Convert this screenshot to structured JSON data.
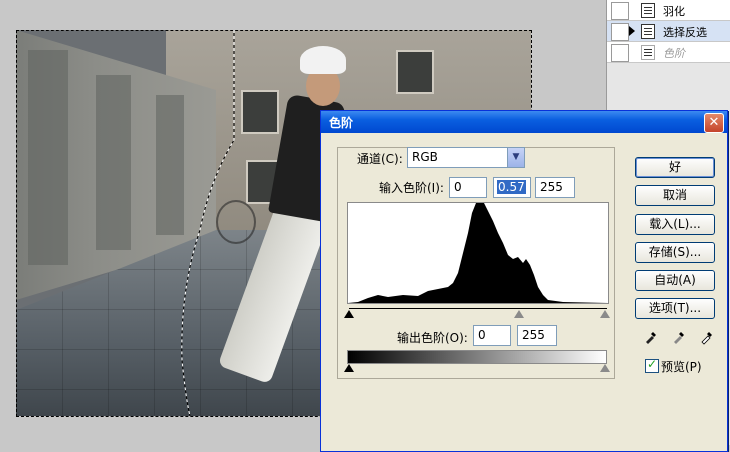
{
  "history": {
    "items": [
      {
        "label": "羽化",
        "state": "normal"
      },
      {
        "label": "选择反选",
        "state": "selected"
      },
      {
        "label": "色阶",
        "state": "dim"
      }
    ]
  },
  "dialog": {
    "title": "色阶",
    "close_label": "✕",
    "channel_label": "通道(C):",
    "channel_value": "RGB",
    "input_levels_label": "输入色阶(I):",
    "input_black": "0",
    "input_gamma": "0.57",
    "input_white": "255",
    "output_levels_label": "输出色阶(O):",
    "output_black": "0",
    "output_white": "255",
    "buttons": {
      "ok": "好",
      "cancel": "取消",
      "load": "载入(L)...",
      "save": "存储(S)...",
      "auto": "自动(A)",
      "options": "选项(T)..."
    },
    "preview_label": "预览(P)",
    "preview_checked": true
  },
  "colors": {
    "titlebar": "#0a5fe0",
    "dialog_bg": "#ece9d8",
    "selection_highlight": "#316ac5"
  }
}
